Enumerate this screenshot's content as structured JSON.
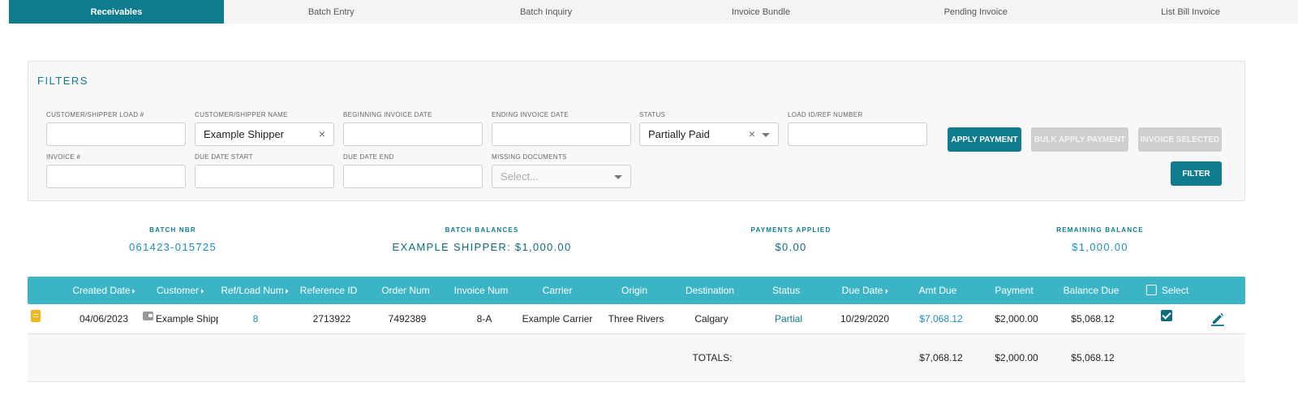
{
  "tabs": [
    "Receivables",
    "Batch Entry",
    "Batch Inquiry",
    "Invoice Bundle",
    "Pending Invoice",
    "List Bill Invoice"
  ],
  "filters": {
    "title": "FILTERS",
    "customer_load_label": "CUSTOMER/SHIPPER LOAD #",
    "customer_load_value": "",
    "customer_name_label": "CUSTOMER/SHIPPER NAME",
    "customer_name_value": "Example Shipper",
    "begin_date_label": "BEGINNING INVOICE DATE",
    "begin_date_value": "",
    "end_date_label": "ENDING INVOICE DATE",
    "end_date_value": "",
    "status_label": "STATUS",
    "status_value": "Partially Paid",
    "load_ref_label": "LOAD ID/REF NUMBER",
    "load_ref_value": "",
    "invoice_label": "INVOICE #",
    "invoice_value": "",
    "due_start_label": "DUE DATE START",
    "due_start_value": "",
    "due_end_label": "DUE DATE END",
    "due_end_value": "",
    "missing_docs_label": "MISSING DOCUMENTS",
    "missing_docs_placeholder": "Select...",
    "clear_glyph": "×"
  },
  "buttons": {
    "apply_payment": "APPLY PAYMENT",
    "bulk_apply_payment": "BULK APPLY PAYMENT",
    "invoice_selected": "INVOICE SELECTED",
    "filter": "FILTER"
  },
  "summary": {
    "batch_nbr_label": "BATCH NBR",
    "batch_nbr_value": "061423-015725",
    "batch_balances_label": "BATCH BALANCES",
    "batch_balances_value": "EXAMPLE SHIPPER: $1,000.00",
    "payments_applied_label": "PAYMENTS APPLIED",
    "payments_applied_value": "$0.00",
    "remaining_balance_label": "REMAINING BALANCE",
    "remaining_balance_value": "$1,000.00"
  },
  "table": {
    "headers": {
      "created_date": "Created Date",
      "customer": "Customer",
      "ref_load": "Ref/Load Num",
      "reference_id": "Reference ID",
      "order_num": "Order Num",
      "invoice_num": "Invoice Num",
      "carrier": "Carrier",
      "origin": "Origin",
      "destination": "Destination",
      "status": "Status",
      "due_date": "Due Date",
      "amt_due": "Amt Due",
      "payment": "Payment",
      "balance_due": "Balance Due",
      "select": "Select"
    },
    "row": {
      "created_date": "04/06/2023",
      "customer": "Example Shipper",
      "ref_load": "8",
      "reference_id": "2713922",
      "order_num": "7492389",
      "invoice_num": "8-A",
      "carrier": "Example Carrier",
      "origin": "Three Rivers",
      "destination": "Calgary",
      "status": "Partial",
      "due_date": "10/29/2020",
      "amt_due": "$7,068.12",
      "payment": "$2,000.00",
      "balance_due": "$5,068.12",
      "selected": true
    },
    "totals": {
      "label": "TOTALS:",
      "amt_due": "$7,068.12",
      "payment": "$2,000.00",
      "balance_due": "$5,068.12"
    }
  },
  "colors": {
    "accent": "#0e7c8c",
    "header_bg": "#3bb4c5",
    "link": "#1a8fbf",
    "doc_icon": "#f2b51d"
  },
  "icons": [
    "document-icon",
    "wallet-icon",
    "checkbox-checked-icon",
    "edit-icon",
    "sort-icon",
    "clear-icon",
    "chevron-down-icon"
  ]
}
